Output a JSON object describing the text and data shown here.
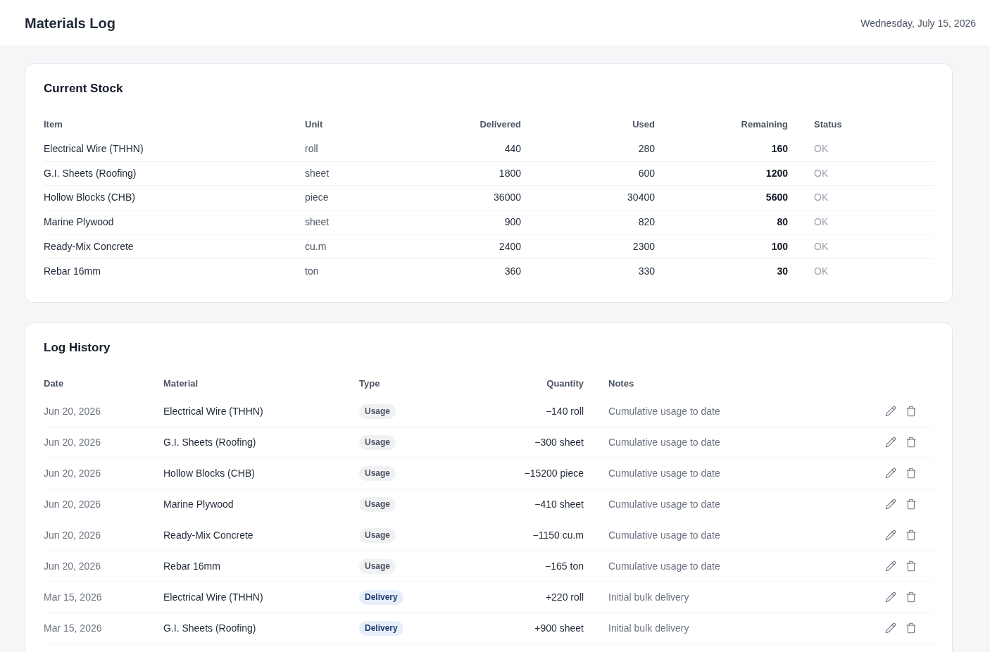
{
  "header": {
    "title": "Materials Log",
    "date": "Wednesday, July 15, 2026"
  },
  "current_stock": {
    "title": "Current Stock",
    "columns": [
      "Item",
      "Unit",
      "Delivered",
      "Used",
      "Remaining",
      "Status"
    ],
    "rows": [
      {
        "item": "Electrical Wire (THHN)",
        "unit": "roll",
        "delivered": "440",
        "used": "280",
        "remaining": "160",
        "status": "OK"
      },
      {
        "item": "G.I. Sheets (Roofing)",
        "unit": "sheet",
        "delivered": "1800",
        "used": "600",
        "remaining": "1200",
        "status": "OK"
      },
      {
        "item": "Hollow Blocks (CHB)",
        "unit": "piece",
        "delivered": "36000",
        "used": "30400",
        "remaining": "5600",
        "status": "OK"
      },
      {
        "item": "Marine Plywood",
        "unit": "sheet",
        "delivered": "900",
        "used": "820",
        "remaining": "80",
        "status": "OK"
      },
      {
        "item": "Ready-Mix Concrete",
        "unit": "cu.m",
        "delivered": "2400",
        "used": "2300",
        "remaining": "100",
        "status": "OK"
      },
      {
        "item": "Rebar 16mm",
        "unit": "ton",
        "delivered": "360",
        "used": "330",
        "remaining": "30",
        "status": "OK"
      }
    ]
  },
  "log_history": {
    "title": "Log History",
    "columns": [
      "Date",
      "Material",
      "Type",
      "Quantity",
      "Notes"
    ],
    "rows": [
      {
        "date": "Jun 20, 2026",
        "material": "Electrical Wire (THHN)",
        "type": "Usage",
        "kind": "usage",
        "quantity": "−140 roll",
        "notes": "Cumulative usage to date"
      },
      {
        "date": "Jun 20, 2026",
        "material": "G.I. Sheets (Roofing)",
        "type": "Usage",
        "kind": "usage",
        "quantity": "−300 sheet",
        "notes": "Cumulative usage to date"
      },
      {
        "date": "Jun 20, 2026",
        "material": "Hollow Blocks (CHB)",
        "type": "Usage",
        "kind": "usage",
        "quantity": "−15200 piece",
        "notes": "Cumulative usage to date"
      },
      {
        "date": "Jun 20, 2026",
        "material": "Marine Plywood",
        "type": "Usage",
        "kind": "usage",
        "quantity": "−410 sheet",
        "notes": "Cumulative usage to date"
      },
      {
        "date": "Jun 20, 2026",
        "material": "Ready-Mix Concrete",
        "type": "Usage",
        "kind": "usage",
        "quantity": "−1150 cu.m",
        "notes": "Cumulative usage to date"
      },
      {
        "date": "Jun 20, 2026",
        "material": "Rebar 16mm",
        "type": "Usage",
        "kind": "usage",
        "quantity": "−165 ton",
        "notes": "Cumulative usage to date"
      },
      {
        "date": "Mar 15, 2026",
        "material": "Electrical Wire (THHN)",
        "type": "Delivery",
        "kind": "delivery",
        "quantity": "+220 roll",
        "notes": "Initial bulk delivery"
      },
      {
        "date": "Mar 15, 2026",
        "material": "G.I. Sheets (Roofing)",
        "type": "Delivery",
        "kind": "delivery",
        "quantity": "+900 sheet",
        "notes": "Initial bulk delivery"
      }
    ]
  }
}
